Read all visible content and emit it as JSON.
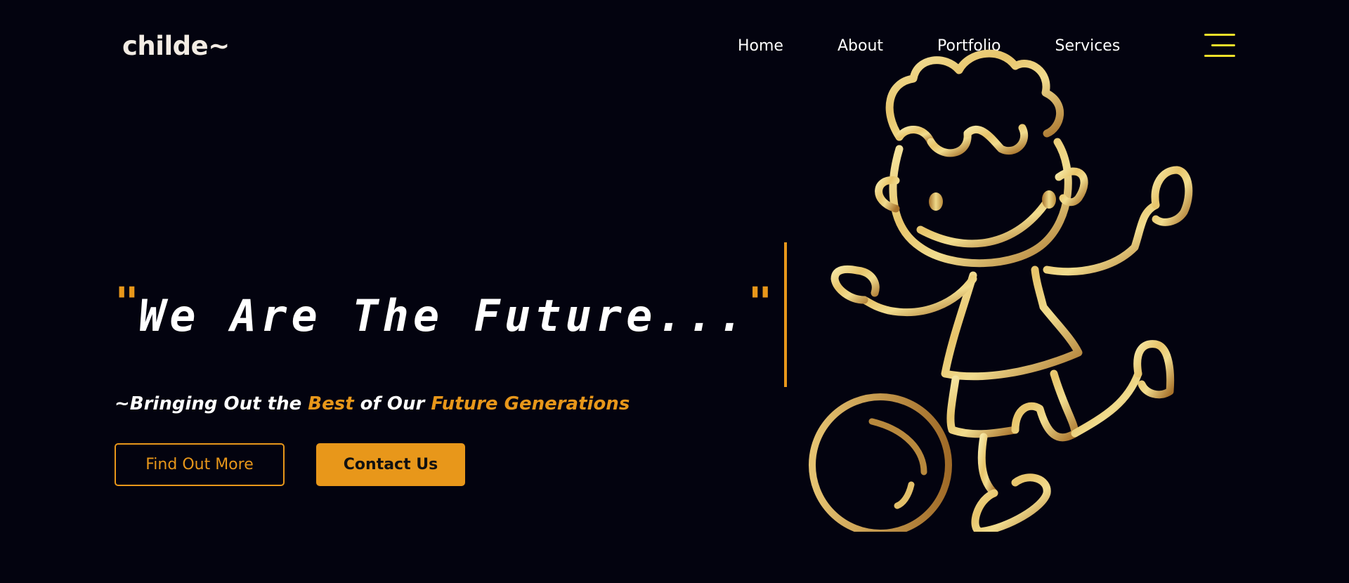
{
  "header": {
    "logo": "childe~"
  },
  "nav": {
    "items": [
      {
        "label": "Home"
      },
      {
        "label": "About"
      },
      {
        "label": "Portfolio"
      },
      {
        "label": "Services"
      }
    ],
    "menu_icon": "hamburger-menu-icon"
  },
  "hero": {
    "quote_open": "\"",
    "headline": "We Are The Future...",
    "quote_close": "\"",
    "tagline": {
      "part1": "~Bringing Out the ",
      "accent1": "Best",
      "part2": " of Our ",
      "accent2": "Future Generations"
    },
    "buttons": {
      "find_out_more": "Find Out More",
      "contact_us": "Contact Us"
    },
    "illustration_icon": "child-playing-ball-illustration-icon"
  },
  "colors": {
    "background": "#03030f",
    "accent": "#e8971a",
    "menu_icon": "#f2e02a",
    "gold_light": "#f4e39a",
    "gold_dark": "#a8732c"
  }
}
